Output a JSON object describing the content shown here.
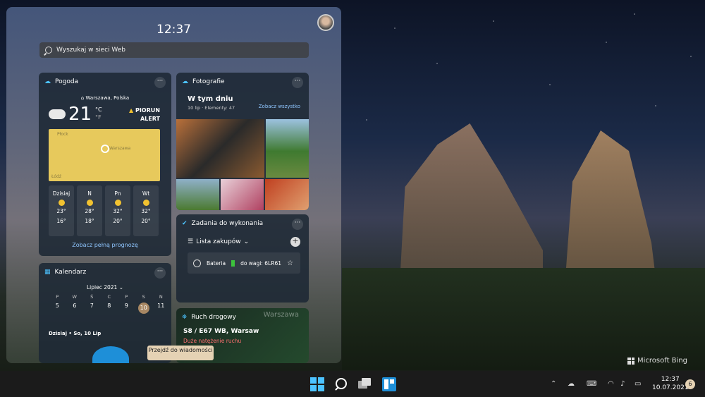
{
  "panel": {
    "time": "12:37",
    "search_placeholder": "Wyszukaj w sieci Web"
  },
  "weather": {
    "title": "Pogoda",
    "location": "Warszawa, Polska",
    "temp": "21",
    "unit_c": "°C",
    "unit_f": "°F",
    "alert_line1": "PIORUN",
    "alert_line2": "ALERT",
    "map_label1": "Płock",
    "map_label2": "Warszawa",
    "map_label3": "Łódź",
    "days": [
      {
        "name": "Dzisiaj",
        "high": "23°",
        "low": "16°"
      },
      {
        "name": "N",
        "high": "28°",
        "low": "18°"
      },
      {
        "name": "Pn",
        "high": "32°",
        "low": "20°"
      },
      {
        "name": "Wt",
        "high": "32°",
        "low": "20°"
      }
    ],
    "link": "Zobacz pełną prognozę"
  },
  "photos": {
    "title": "Fotografie",
    "heading": "W tym dniu",
    "sub": "10 lip · Elementy: 47",
    "link": "Zobacz wszystko"
  },
  "tasks": {
    "title": "Zadania do wykonania",
    "list": "Lista zakupów",
    "item_pre": "Bateria",
    "item_post": "do wagi: 6LR61"
  },
  "calendar": {
    "title": "Kalendarz",
    "month": "Lipiec 2021",
    "headers": [
      "P",
      "W",
      "Ś",
      "C",
      "P",
      "S",
      "N"
    ],
    "days": [
      "5",
      "6",
      "7",
      "8",
      "9",
      "10",
      "11"
    ],
    "footer": "Dzisiaj • So, 10 Lip"
  },
  "traffic": {
    "title": "Ruch drogowy",
    "road": "S8 / E67 WB, Warsaw",
    "status": "Duże natężenie ruchu",
    "city": "Warszawa"
  },
  "go_news": "Przejdź do wiadomości",
  "bing": "Microsoft Bing",
  "taskbar": {
    "time": "12:37",
    "date": "10.07.2021",
    "notifications": "6"
  }
}
